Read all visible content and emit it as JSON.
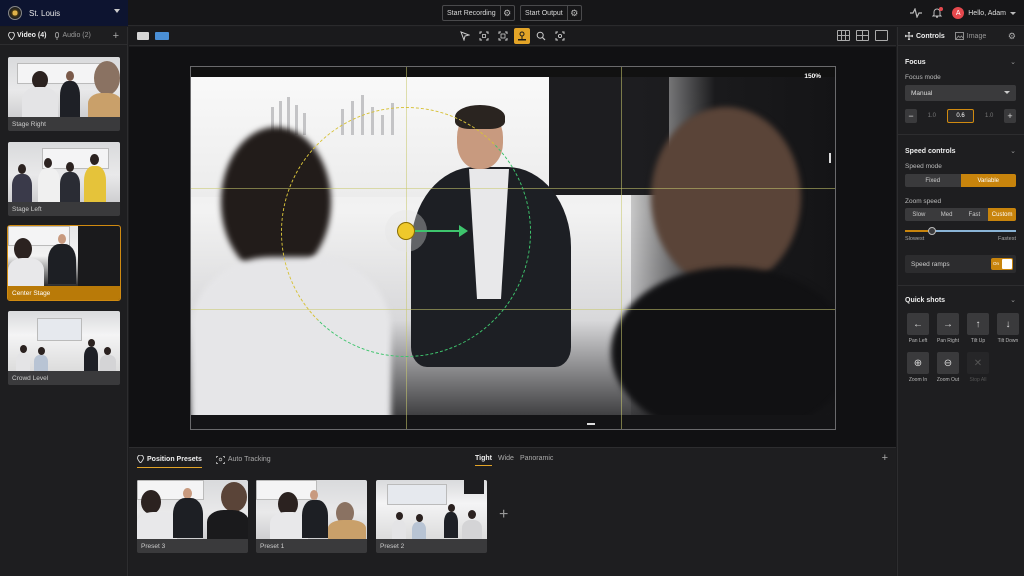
{
  "org": {
    "name": "St. Louis"
  },
  "toolbar": {
    "start_recording": "Start Recording",
    "start_output": "Start Output",
    "greeting": "Hello, Adam",
    "avatar_initial": "A"
  },
  "left_panel": {
    "tabs": [
      {
        "label": "Video (4)",
        "icon": "location-pin-icon",
        "active": true
      },
      {
        "label": "Audio (2)",
        "icon": "microphone-icon",
        "active": false
      }
    ],
    "cameras": [
      {
        "label": "Stage Right",
        "active": false
      },
      {
        "label": "Stage Left",
        "active": false
      },
      {
        "label": "Center Stage",
        "active": true
      },
      {
        "label": "Crowd Level",
        "active": false
      }
    ]
  },
  "viewer": {
    "zoom_readout": "150%",
    "tools": [
      "pointer-icon",
      "crop-expand-icon",
      "crop-select-icon",
      "ptz-joystick-icon",
      "zoom-icon",
      "focus-target-icon"
    ],
    "active_tool": "ptz-joystick-icon"
  },
  "presets": {
    "tabs": [
      {
        "label": "Position Presets",
        "icon": "location-pin-icon",
        "active": true
      },
      {
        "label": "Auto Tracking",
        "icon": "tracking-icon",
        "active": false
      }
    ],
    "modes": [
      {
        "label": "Tight",
        "active": true
      },
      {
        "label": "Wide",
        "active": false
      },
      {
        "label": "Panoramic",
        "active": false
      }
    ],
    "items": [
      "Preset 3",
      "Preset 1",
      "Preset 2"
    ]
  },
  "right_panel": {
    "tabs": [
      {
        "label": "Controls",
        "icon": "move-icon",
        "active": true
      },
      {
        "label": "Image",
        "icon": "image-icon",
        "active": false
      }
    ],
    "focus": {
      "title": "Focus",
      "mode_label": "Focus mode",
      "mode_value": "Manual",
      "stepper": {
        "prev": "1.0",
        "current": "0.6",
        "next": "1.0"
      }
    },
    "speed": {
      "title": "Speed controls",
      "mode_label": "Speed mode",
      "modes": [
        {
          "label": "Fixed",
          "active": false
        },
        {
          "label": "Variable",
          "active": true
        }
      ],
      "zoom_label": "Zoom speed",
      "zoom_options": [
        {
          "label": "Slow",
          "active": false
        },
        {
          "label": "Med",
          "active": false
        },
        {
          "label": "Fast",
          "active": false
        },
        {
          "label": "Custom",
          "active": true
        }
      ],
      "slider_value": 0.24,
      "slider_min_label": "Slowest",
      "slider_max_label": "Fastest",
      "ramps_label": "Speed ramps",
      "ramps_state": "On"
    },
    "quick_shots": {
      "title": "Quick shots",
      "items": [
        {
          "label": "Pan Left",
          "glyph": "←",
          "icon": "arrow-left-icon",
          "enabled": true
        },
        {
          "label": "Pan Right",
          "glyph": "→",
          "icon": "arrow-right-icon",
          "enabled": true
        },
        {
          "label": "Tilt Up",
          "glyph": "↑",
          "icon": "arrow-up-icon",
          "enabled": true
        },
        {
          "label": "Tilt Down",
          "glyph": "↓",
          "icon": "arrow-down-icon",
          "enabled": true
        },
        {
          "label": "Zoom In",
          "glyph": "⊕",
          "icon": "zoom-in-icon",
          "enabled": true
        },
        {
          "label": "Zoom Out",
          "glyph": "⊖",
          "icon": "zoom-out-icon",
          "enabled": true
        },
        {
          "label": "Stop All",
          "glyph": "✕",
          "icon": "stop-icon",
          "enabled": false
        }
      ]
    }
  },
  "colors": {
    "accent": "#c8840c",
    "ptz_dot": "#efc92b",
    "ptz_vector": "#3ec46d",
    "alert": "#e5484d"
  }
}
